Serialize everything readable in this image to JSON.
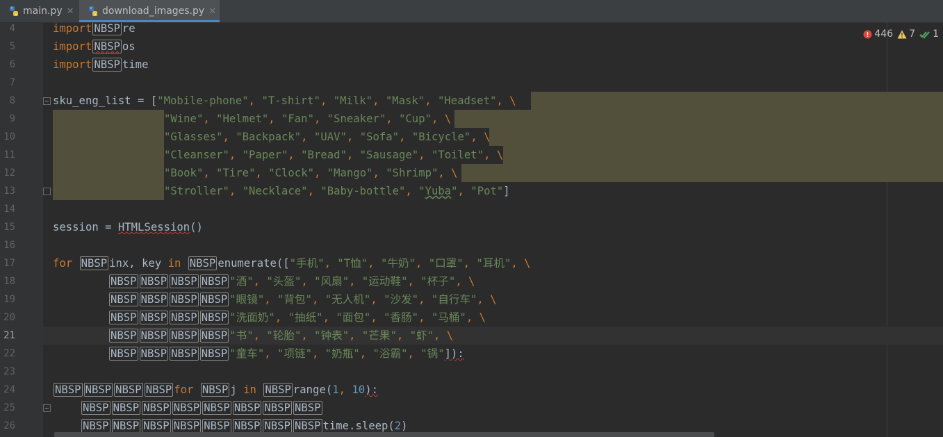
{
  "tabs": [
    {
      "label": "main.py",
      "active": false
    },
    {
      "label": "download_images.py",
      "active": true
    }
  ],
  "inspections": {
    "errors": "446",
    "warnings": "7",
    "ok": "1"
  },
  "colors": {
    "keyword": "#cc7832",
    "string": "#6a8759",
    "number": "#6897bb",
    "text": "#a9b7c6",
    "selection": "#52503a",
    "tab_underline": "#4a88c7"
  },
  "line_numbers": [
    "4",
    "5",
    "6",
    "7",
    "8",
    "9",
    "10",
    "11",
    "12",
    "13",
    "14",
    "15",
    "16",
    "17",
    "18",
    "19",
    "20",
    "21",
    "22",
    "23",
    "24",
    "25",
    "26"
  ],
  "current_line": "21",
  "code": {
    "l4": [
      "import",
      "NBSP",
      "re"
    ],
    "l5": [
      "import",
      "NBSP",
      "os"
    ],
    "l6": [
      "import",
      "NBSP",
      "time"
    ],
    "l8": [
      "sku_eng_list = [",
      "\"Mobile-phone\"",
      ", ",
      "\"T-shirt\"",
      ", ",
      "\"Milk\"",
      ", ",
      "\"Mask\"",
      ", ",
      "\"Headset\"",
      ", \\"
    ],
    "l9": [
      "\"Wine\"",
      ", ",
      "\"Helmet\"",
      ", ",
      "\"Fan\"",
      ", ",
      "\"Sneaker\"",
      ", ",
      "\"Cup\"",
      ", \\"
    ],
    "l10": [
      "\"Glasses\"",
      ", ",
      "\"Backpack\"",
      ", ",
      "\"UAV\"",
      ", ",
      "\"Sofa\"",
      ", ",
      "\"Bicycle\"",
      ", \\"
    ],
    "l11": [
      "\"Cleanser\"",
      ", ",
      "\"Paper\"",
      ", ",
      "\"Bread\"",
      ", ",
      "\"Sausage\"",
      ", ",
      "\"Toilet\"",
      ", \\"
    ],
    "l12": [
      "\"Book\"",
      ", ",
      "\"Tire\"",
      ", ",
      "\"Clock\"",
      ", ",
      "\"Mango\"",
      ", ",
      "\"Shrimp\"",
      ", \\"
    ],
    "l13": [
      "\"Stroller\"",
      ", ",
      "\"Necklace\"",
      ", ",
      "\"Baby-bottle\"",
      ", ",
      "\"",
      "Yuba",
      "\"",
      ", ",
      "\"Pot\"",
      "]"
    ],
    "l15": [
      "session = ",
      "HTMLSession",
      "()"
    ],
    "l17": [
      "for",
      " ",
      "NBSP",
      "inx, key ",
      "in",
      " ",
      "NBSP",
      "enumerate([",
      "\"手机\"",
      ", ",
      "\"T恤\"",
      ", ",
      "\"牛奶\"",
      ", ",
      "\"口罩\"",
      ", ",
      "\"耳机\"",
      ", \\"
    ],
    "l18": [
      "\"酒\"",
      ", ",
      "\"头盔\"",
      ", ",
      "\"风扇\"",
      ", ",
      "\"运动鞋\"",
      ", ",
      "\"杯子\"",
      ", \\"
    ],
    "l19": [
      "\"眼镜\"",
      ", ",
      "\"背包\"",
      ", ",
      "\"无人机\"",
      ", ",
      "\"沙发\"",
      ", ",
      "\"自行车\"",
      ", \\"
    ],
    "l20": [
      "\"洗面奶\"",
      ", ",
      "\"抽纸\"",
      ", ",
      "\"面包\"",
      ", ",
      "\"香肠\"",
      ", ",
      "\"马桶\"",
      ", \\"
    ],
    "l21": [
      "\"书\"",
      ", ",
      "\"轮胎\"",
      ", ",
      "\"钟表\"",
      ", ",
      "\"芒果\"",
      ", ",
      "\"虾\"",
      ", \\"
    ],
    "l22": [
      "\"童车\"",
      ", ",
      "\"项链\"",
      ", ",
      "\"奶瓶\"",
      ", ",
      "\"浴霸\"",
      ", ",
      "\"锅\"",
      "]):"
    ],
    "l24": [
      "for",
      " ",
      "NBSP",
      "j ",
      "in",
      " ",
      "NBSP",
      "range(",
      "1",
      ", ",
      "10",
      "):"
    ],
    "l26": [
      "time.sleep(",
      "2",
      ")"
    ],
    "nbsp": "NBSP"
  }
}
